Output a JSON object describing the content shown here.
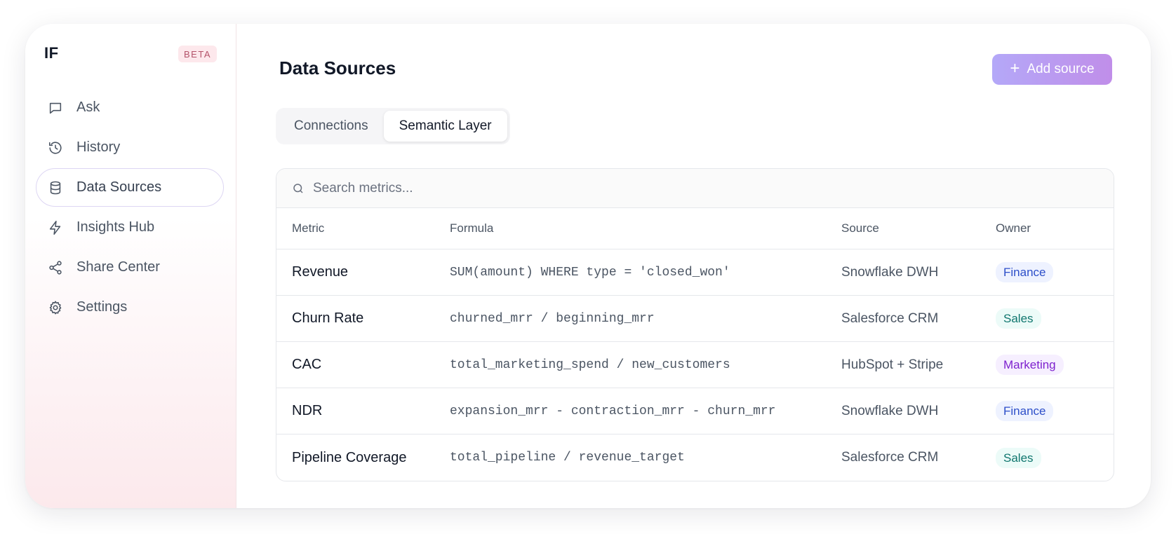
{
  "sidebar": {
    "brand": "IF",
    "badge": "BETA",
    "items": [
      {
        "label": "Ask",
        "icon": "chat-icon",
        "active": false
      },
      {
        "label": "History",
        "icon": "history-icon",
        "active": false
      },
      {
        "label": "Data Sources",
        "icon": "database-icon",
        "active": true
      },
      {
        "label": "Insights Hub",
        "icon": "lightning-icon",
        "active": false
      },
      {
        "label": "Share Center",
        "icon": "share-icon",
        "active": false
      },
      {
        "label": "Settings",
        "icon": "gear-icon",
        "active": false
      }
    ]
  },
  "header": {
    "title": "Data Sources",
    "add_button_label": "Add source",
    "add_button_icon": "plus-icon"
  },
  "tabs": [
    {
      "label": "Connections",
      "active": false
    },
    {
      "label": "Semantic Layer",
      "active": true
    }
  ],
  "search": {
    "placeholder": "Search metrics...",
    "value": ""
  },
  "table": {
    "columns": [
      "Metric",
      "Formula",
      "Source",
      "Owner"
    ],
    "rows": [
      {
        "metric": "Revenue",
        "formula": "SUM(amount) WHERE type = 'closed_won'",
        "source": "Snowflake DWH",
        "owner": "Finance"
      },
      {
        "metric": "Churn Rate",
        "formula": "churned_mrr / beginning_mrr",
        "source": "Salesforce CRM",
        "owner": "Sales"
      },
      {
        "metric": "CAC",
        "formula": "total_marketing_spend / new_customers",
        "source": "HubSpot + Stripe",
        "owner": "Marketing"
      },
      {
        "metric": "NDR",
        "formula": "expansion_mrr - contraction_mrr - churn_mrr",
        "source": "Snowflake DWH",
        "owner": "Finance"
      },
      {
        "metric": "Pipeline Coverage",
        "formula": "total_pipeline / revenue_target",
        "source": "Salesforce CRM",
        "owner": "Sales"
      }
    ]
  },
  "owner_colors": {
    "Finance": {
      "bg": "#eef2ff",
      "fg": "#2d4fc9"
    },
    "Sales": {
      "bg": "#ecfbf8",
      "fg": "#0f766e"
    },
    "Marketing": {
      "bg": "#f6efff",
      "fg": "#7e22ce"
    }
  },
  "colors": {
    "accent_start": "#b4a8f8",
    "accent_end": "#c08ee9",
    "beta_bg": "#fde8ec",
    "beta_fg": "#b4536a"
  }
}
